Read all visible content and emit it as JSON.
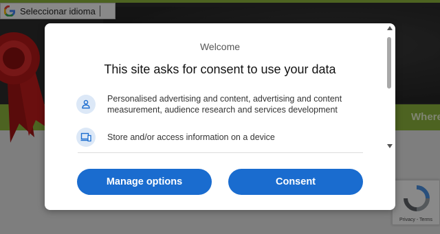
{
  "language_bar": {
    "label": "Seleccionar idioma",
    "logo_icon": "google-g-icon"
  },
  "site": {
    "nav_link": "Where"
  },
  "consent_dialog": {
    "welcome": "Welcome",
    "title": "This site asks for consent to use your data",
    "purposes": [
      {
        "icon": "person-icon",
        "text": "Personalised advertising and content, advertising and content measurement, audience research and services development"
      },
      {
        "icon": "devices-icon",
        "text": "Store and/or access information on a device"
      }
    ],
    "manage_label": "Manage options",
    "consent_label": "Consent"
  },
  "recaptcha": {
    "links": "Privacy - Terms"
  },
  "colors": {
    "primary_button": "#1a6ccf",
    "nav_green": "#8db43c",
    "icon_circle": "#dce8f7"
  }
}
